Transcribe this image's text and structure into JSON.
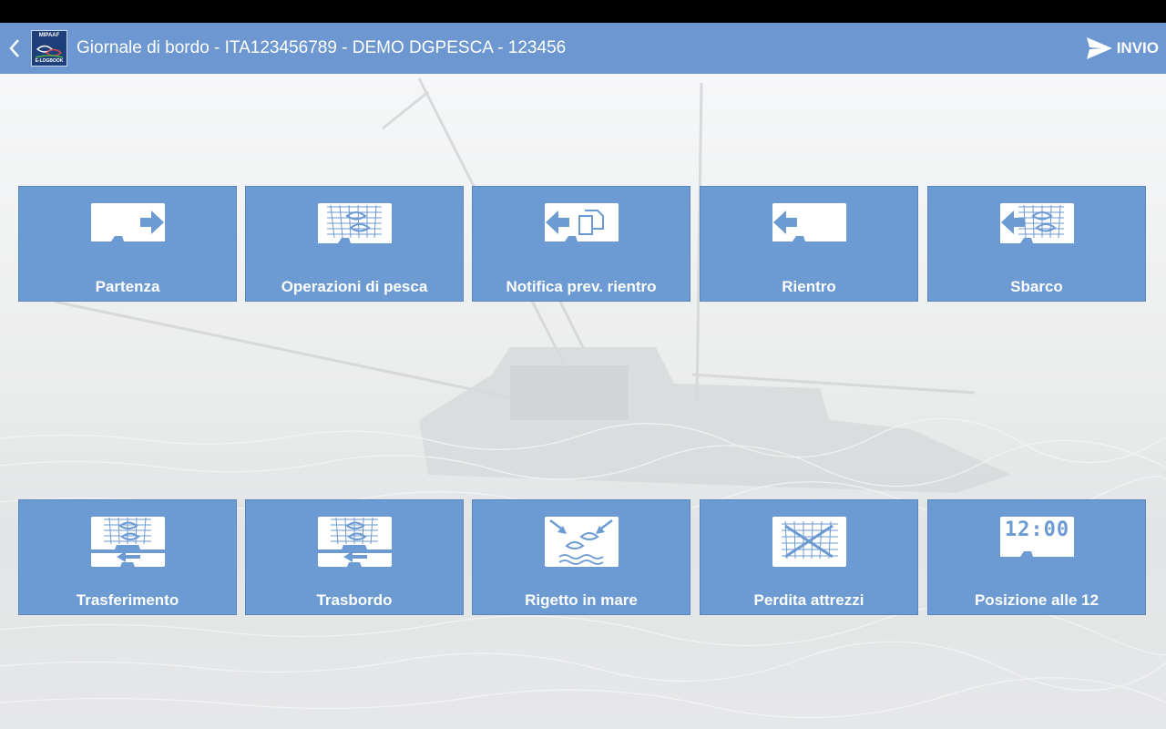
{
  "appbar": {
    "title": "Giornale di bordo - ITA123456789 - DEMO DGPESCA - 123456",
    "logo_top": "MIPAAF",
    "logo_bottom": "E-LOGBOOK",
    "send_label": "INVIO"
  },
  "tiles": {
    "partenza": {
      "label": "Partenza",
      "icon": "departure-icon"
    },
    "operazioni": {
      "label": "Operazioni di pesca",
      "icon": "fishing-net-icon"
    },
    "notifica": {
      "label": "Notifica prev. rientro",
      "icon": "return-notice-icon"
    },
    "rientro": {
      "label": "Rientro",
      "icon": "return-icon"
    },
    "sbarco": {
      "label": "Sbarco",
      "icon": "landing-icon"
    },
    "trasferimento": {
      "label": "Trasferimento",
      "icon": "transfer-icon"
    },
    "trasbordo": {
      "label": "Trasbordo",
      "icon": "transshipment-icon"
    },
    "rigetto": {
      "label": "Rigetto in mare",
      "icon": "discard-icon"
    },
    "perdita": {
      "label": "Perdita attrezzi",
      "icon": "gear-loss-icon"
    },
    "posizione": {
      "label": "Posizione alle 12",
      "icon": "noon-position-icon",
      "clock": "12:00"
    }
  },
  "colors": {
    "accent": "#6c97d0",
    "tile": "#6c9ad2",
    "statusbar": "#000000"
  }
}
